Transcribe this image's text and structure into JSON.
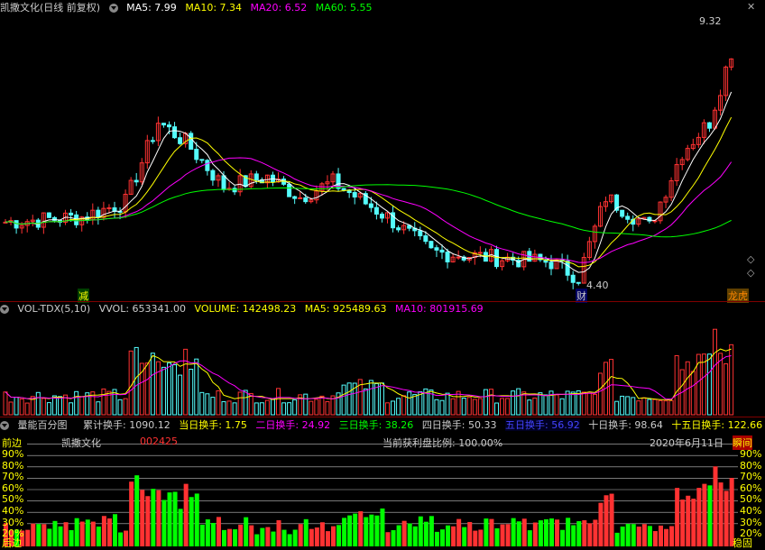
{
  "main_header": {
    "stock_title": "凯撒文化(日线 前复权)",
    "ma5": "MA5: 7.99",
    "ma10": "MA10: 7.34",
    "ma20": "MA20: 6.52",
    "ma60": "MA60: 5.55"
  },
  "price_labels": {
    "high": "9.32",
    "low": "4.40"
  },
  "markers": {
    "reduce": "减",
    "finance": "财",
    "dragon": "龙虎"
  },
  "vol_header": {
    "indicator": "VOL-TDX(5,10)",
    "vvol": "VVOL: 653341.00",
    "volume": "VOLUME: 142498.23",
    "ma5": "MA5: 925489.63",
    "ma10": "MA10: 801915.69"
  },
  "turnover_header": {
    "title": "量能百分图",
    "cum": "累计换手: 1090.12",
    "d1": "当日换手: 1.75",
    "d2": "二日换手: 24.92",
    "d3": "三日换手: 38.26",
    "d4": "四日换手: 50.33",
    "d5": "五日换手: 56.92",
    "d10": "十日换手: 98.64",
    "d15": "十五日换手: 122.66"
  },
  "pct_panel": {
    "left_top": "前边",
    "left_bottom": "后边",
    "stock_name": "凯撒文化",
    "stock_code": "002425",
    "profit_ratio": "当前获利盘比例: 100.00%",
    "date": "2020年6月11日",
    "right_top": "瞬间",
    "right_bottom": "稳固",
    "levels": [
      "90%",
      "80%",
      "70%",
      "60%",
      "50%",
      "40%",
      "30%",
      "20%"
    ]
  },
  "colors": {
    "up": "#ff3232",
    "down": "#54fcfc",
    "ma5": "#ffffff",
    "ma10": "#ffff00",
    "ma20": "#ff00ff",
    "ma60": "#00ff00",
    "grid": "#800000",
    "green_bar": "#00ff00"
  },
  "icons": [
    "dropdown-triangle-icon",
    "close-icon",
    "diamond-icon",
    "settings-circle-icon"
  ]
}
